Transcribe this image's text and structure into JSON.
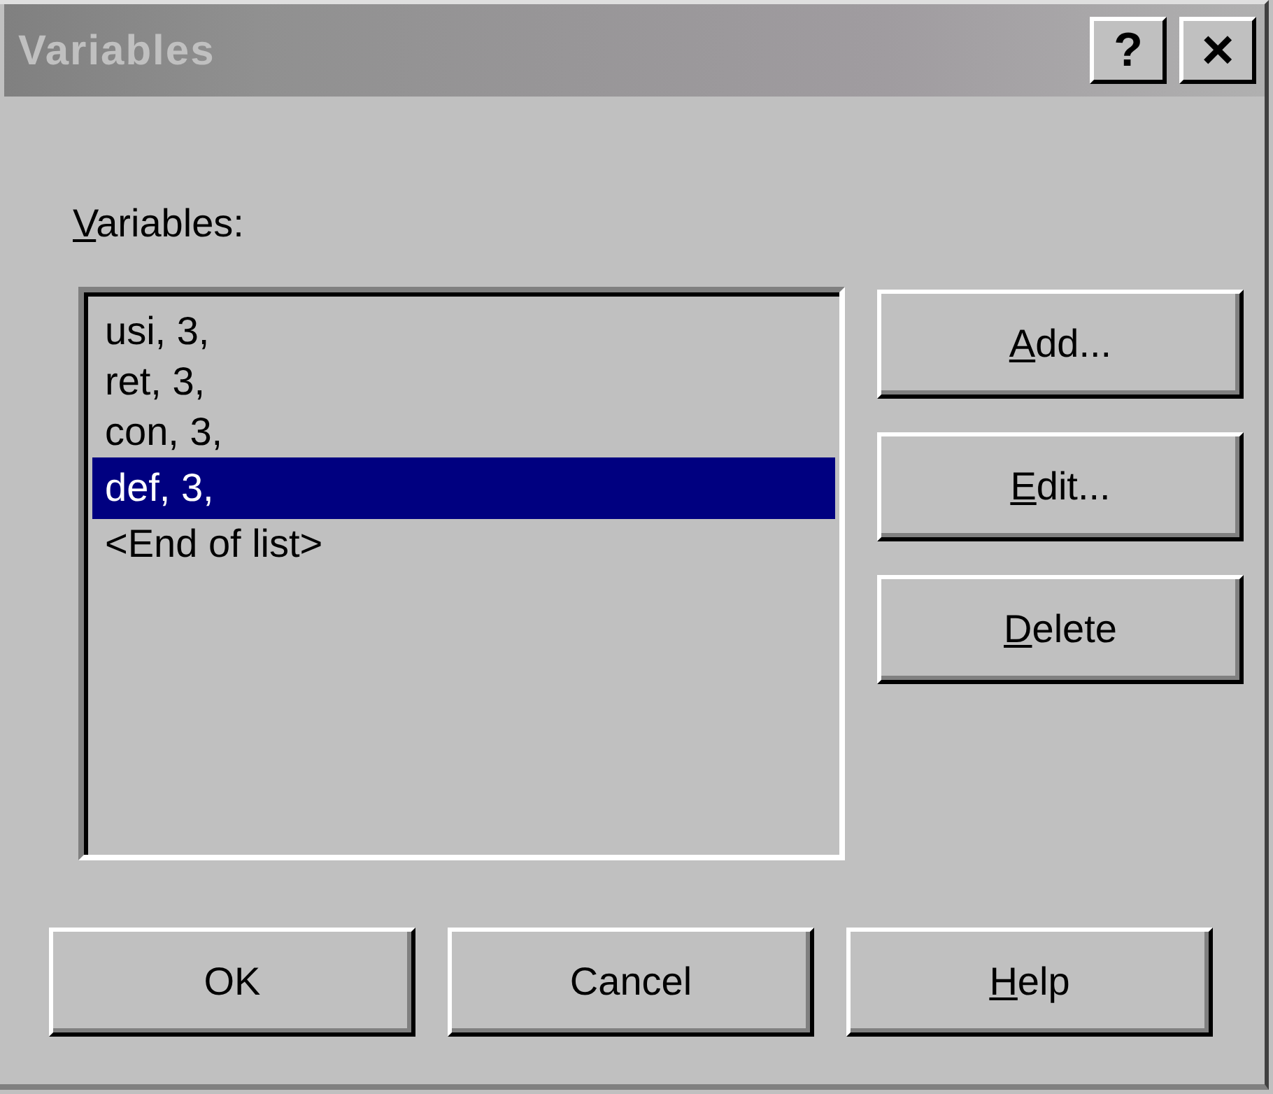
{
  "window": {
    "title": "Variables",
    "active": false,
    "title_buttons": [
      {
        "kind": "help",
        "label": "?"
      },
      {
        "kind": "close",
        "label": "×"
      }
    ]
  },
  "list_label": {
    "text": "Variables:",
    "mnemonic": true
  },
  "list_items": [
    {
      "text": "usi, 3,",
      "selected": false
    },
    {
      "text": "ret, 3,",
      "selected": false
    },
    {
      "text": "con, 3,",
      "selected": false
    },
    {
      "text": "def, 3,",
      "selected": true
    },
    {
      "text": "<End of list>",
      "selected": false
    }
  ],
  "side_buttons": [
    {
      "label": "Add...",
      "mnemonic": true
    },
    {
      "label": "Edit...",
      "mnemonic": true
    },
    {
      "label": "Delete",
      "mnemonic": true
    }
  ],
  "bottom_buttons": [
    {
      "label": "OK",
      "mnemonic": false
    },
    {
      "label": "Cancel",
      "mnemonic": false
    },
    {
      "label": "Help",
      "mnemonic": true
    }
  ]
}
